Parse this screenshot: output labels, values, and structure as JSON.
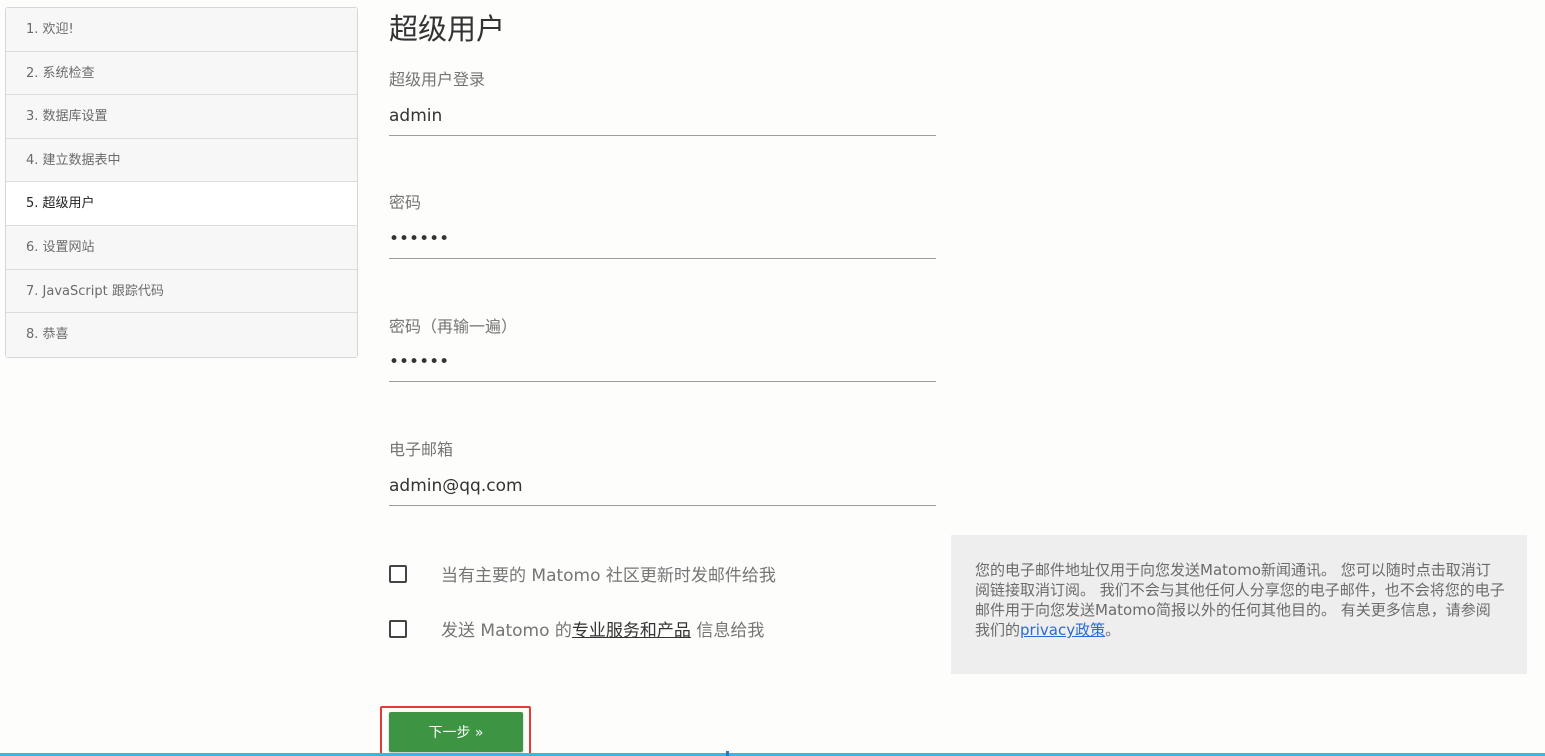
{
  "sidebar": {
    "steps": [
      {
        "label": "1. 欢迎!"
      },
      {
        "label": "2. 系统检查"
      },
      {
        "label": "3. 数据库设置"
      },
      {
        "label": "4. 建立数据表中"
      },
      {
        "label": "5. 超级用户",
        "active": true
      },
      {
        "label": "6. 设置网站"
      },
      {
        "label": "7. JavaScript 跟踪代码"
      },
      {
        "label": "8. 恭喜"
      }
    ]
  },
  "form": {
    "title": "超级用户",
    "login_label": "超级用户登录",
    "login_value": "admin",
    "password_label": "密码",
    "password_value": "••••••",
    "password_repeat_label": "密码（再输一遍）",
    "password_repeat_value": "••••••",
    "email_label": "电子邮箱",
    "email_value": "admin@qq.com",
    "checkbox1_label": "当有主要的 Matomo 社区更新时发邮件给我",
    "checkbox2_prefix": "发送 Matomo 的",
    "checkbox2_link": "专业服务和产品",
    "checkbox2_suffix": " 信息给我",
    "next_button": "下一步 »"
  },
  "info": {
    "text": "您的电子邮件地址仅用于向您发送Matomo新闻通讯。 您可以随时点击取消订阅链接取消订阅。 我们不会与其他任何人分享您的电子邮件，也不会将您的电子邮件用于向您发送Matomo简报以外的任何其他目的。 有关更多信息，请参阅我们的",
    "link": "privacy政策",
    "end": "。"
  },
  "colors": {
    "next_button": "#3d9544",
    "highlight": "#e53935",
    "link": "#2b6bd1",
    "bottom_bar": "#36b7e8"
  }
}
